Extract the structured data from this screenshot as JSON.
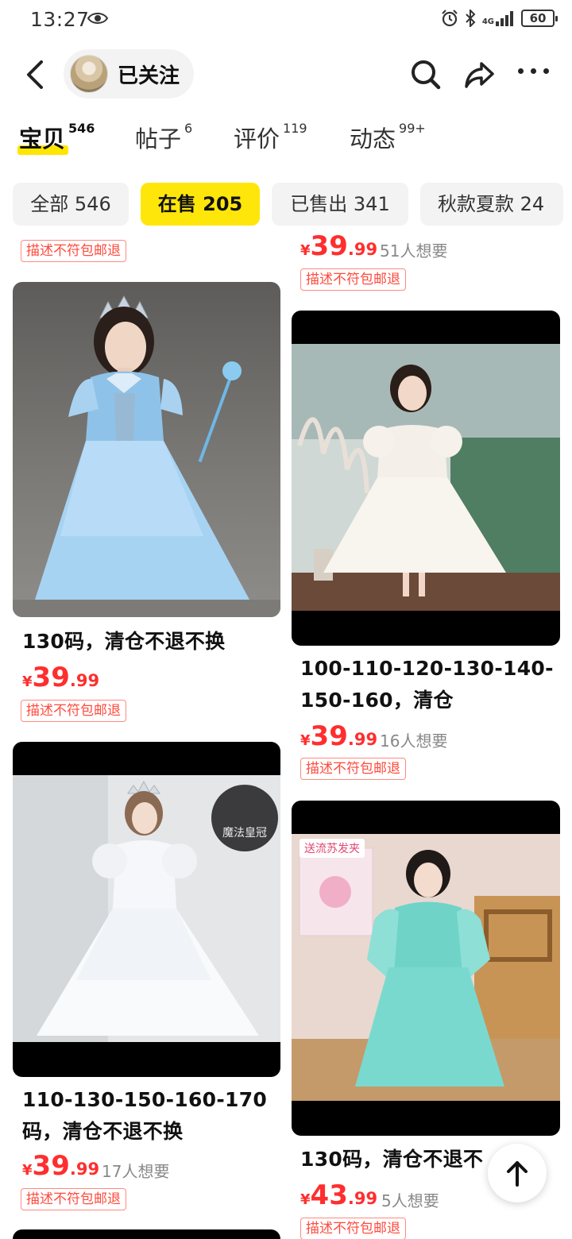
{
  "status_bar": {
    "time": "13:27",
    "battery": "60",
    "network": "4G"
  },
  "header": {
    "follow_label": "已关注"
  },
  "tabs": [
    {
      "label": "宝贝",
      "count": "546"
    },
    {
      "label": "帖子",
      "count": "6"
    },
    {
      "label": "评价",
      "count": "119"
    },
    {
      "label": "动态",
      "count": "99+"
    }
  ],
  "filters": [
    {
      "label": "全部 546"
    },
    {
      "label": "在售 205"
    },
    {
      "label": "已售出 341"
    },
    {
      "label": "秋款夏款 24"
    }
  ],
  "partial_top": {
    "left_tag": "描述不符包邮退",
    "right_price_yen": "¥",
    "right_price_int": "39",
    "right_price_dec": ".99",
    "right_wants": "51人想要",
    "right_tag": "描述不符包邮退"
  },
  "products": [
    {
      "title": "130码，清仓不退不换",
      "price_yen": "¥",
      "price_int": "39",
      "price_dec": ".99",
      "wants": "",
      "tag": "描述不符包邮退",
      "image": "blue-princess-dress"
    },
    {
      "title_lines": [
        "100-110-120-130-140-",
        "150-160，清仓"
      ],
      "price_yen": "¥",
      "price_int": "39",
      "price_dec": ".99",
      "wants": "16人想要",
      "tag": "描述不符包邮退",
      "image": "white-puff-dress"
    },
    {
      "title_lines": [
        "110-130-150-160-170",
        "码，清仓不退不换"
      ],
      "price_yen": "¥",
      "price_int": "39",
      "price_dec": ".99",
      "wants": "17人想要",
      "tag": "描述不符包邮退",
      "image": "white-long-gown",
      "image_badge": "魔法皇冠"
    },
    {
      "title": "130码，清仓不退不",
      "price_yen": "¥",
      "price_int": "43",
      "price_dec": ".99",
      "wants": "5人想要",
      "tag": "描述不符包邮退",
      "image": "teal-hanfu-dress",
      "image_badge": "送流苏发夹"
    }
  ],
  "colors": {
    "accent_yellow": "#ffe60a",
    "price_red": "#ff2e2e"
  },
  "icons": [
    "back-arrow-icon",
    "search-icon",
    "share-icon",
    "more-icon",
    "arrow-up-icon",
    "eye-icon",
    "alarm-icon",
    "bluetooth-icon",
    "signal-icon",
    "battery-icon"
  ]
}
